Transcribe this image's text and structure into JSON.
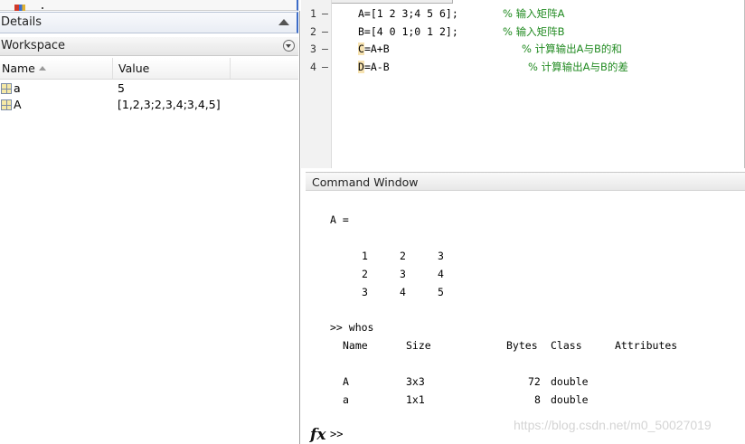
{
  "details_pane": {
    "title": "Details"
  },
  "workspace": {
    "title": "Workspace",
    "columns": [
      "Name",
      "Value"
    ],
    "variables": [
      {
        "name": "a",
        "value": "5"
      },
      {
        "name": "A",
        "value": "[1,2,3;2,3,4;3,4,5]"
      }
    ]
  },
  "editor": {
    "lines": [
      {
        "num": "1",
        "marker": "—",
        "code": "A=[1 2 3;4 5 6];",
        "comment": "% 输入矩阵A"
      },
      {
        "num": "2",
        "marker": "—",
        "code": "B=[4 0 1;0 1 2];",
        "comment": "% 输入矩阵B"
      },
      {
        "num": "3",
        "marker": "—",
        "code_hl": "C",
        "code": "=A+B",
        "comment": "% 计算输出A与B的和"
      },
      {
        "num": "4",
        "marker": "—",
        "code_hl": "D",
        "code": "=A-B",
        "comment": "% 计算输出A与B的差"
      }
    ]
  },
  "command_window": {
    "title": "Command Window",
    "var_label": "A =",
    "matrix_rows": [
      [
        "1",
        "2",
        "3"
      ],
      [
        "2",
        "3",
        "4"
      ],
      [
        "3",
        "4",
        "5"
      ]
    ],
    "whos_cmd": ">> whos",
    "whos_headers": [
      "Name",
      "Size",
      "Bytes",
      "Class",
      "Attributes"
    ],
    "whos_rows": [
      {
        "name": "A",
        "size": "3x3",
        "bytes": "72",
        "class": "double"
      },
      {
        "name": "a",
        "size": "1x1",
        "bytes": "8",
        "class": "double"
      }
    ],
    "prompt": ">>",
    "fx_label": "fx",
    "watermark": "https://blog.csdn.net/m0_50027019"
  },
  "colors": {
    "comment": "#228b22",
    "accent_border": "#3c6cc8",
    "highlight": "#f7e3b2"
  },
  "icons": [
    "variable-grid-icon",
    "sort-ascending-icon",
    "panel-menu-icon",
    "collapse-caret-icon",
    "fx-function-icon"
  ]
}
